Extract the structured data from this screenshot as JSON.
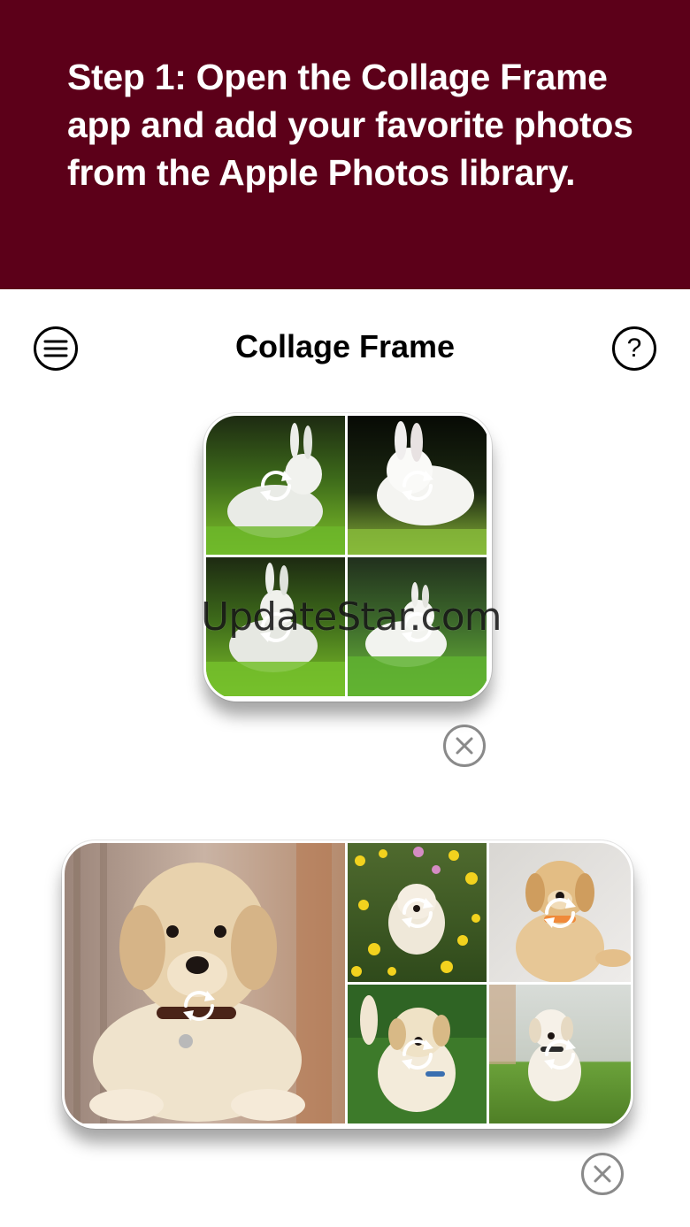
{
  "banner": {
    "text": "Step 1: Open the Collage Frame app and add your favorite photos from the Apple Photos library.",
    "background": "#5c0019"
  },
  "navbar": {
    "title": "Collage Frame",
    "menu_icon": "menu-lines-icon",
    "help_icon": "help-icon",
    "help_symbol": "?"
  },
  "collages": [
    {
      "layout": "2x2 grid",
      "photos": [
        "white rabbit on grass",
        "white rabbit on grass",
        "white rabbit on grass",
        "white rabbit on grass"
      ],
      "cell_icon": "swap-arrows-icon",
      "close_icon": "close-icon"
    },
    {
      "layout": "1 large + 2x2 grid",
      "photos": [
        "golden retriever puppy",
        "puppy in yellow flowers",
        "puppy with orange collar",
        "puppy running on grass",
        "puppy on lawn"
      ],
      "cell_icon": "swap-arrows-icon",
      "close_icon": "close-icon"
    }
  ],
  "watermark": "UpdateStar.com"
}
